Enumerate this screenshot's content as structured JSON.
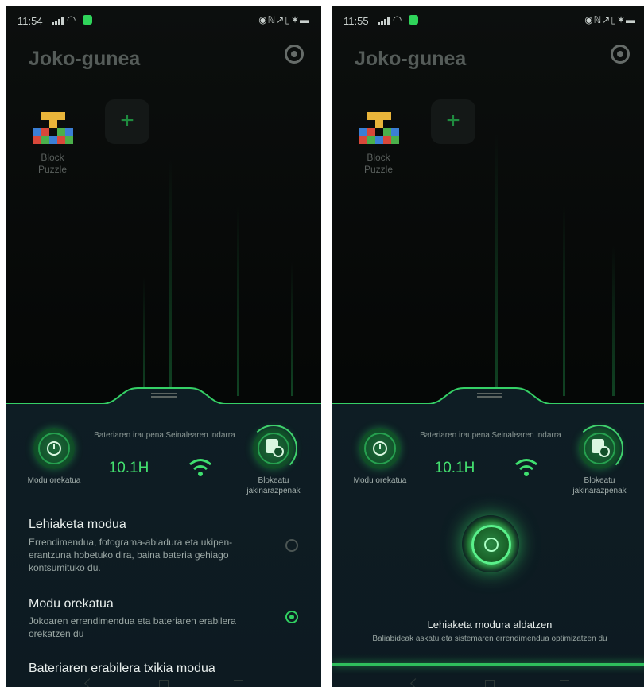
{
  "left": {
    "status_time": "11:54",
    "title": "Joko-gunea",
    "game_label": "Block\nPuzzle",
    "add_symbol": "+",
    "mode_caption": "Modu orekatua",
    "battery_label": "Bateriaren iraupena",
    "battery_value": "10.1H",
    "signal_label": "Seinalearen indarra",
    "block_caption": "Blokeatu jakinarazpenak",
    "options": [
      {
        "title": "Lehiaketa modua",
        "desc": "Errendimendua, fotograma-abiadura eta ukipen-erantzuna hobetuko dira, baina bateria gehiago kontsumituko du.",
        "selected": false
      },
      {
        "title": "Modu orekatua",
        "desc": "Jokoaren errendimendua eta bateriaren erabilera orekatzen du",
        "selected": true
      },
      {
        "title": "Bateriaren erabilera txikia modua",
        "desc": "",
        "selected": false
      }
    ]
  },
  "right": {
    "status_time": "11:55",
    "title": "Joko-gunea",
    "game_label": "Block\nPuzzle",
    "add_symbol": "+",
    "mode_caption": "Modu orekatua",
    "battery_label": "Bateriaren iraupena",
    "battery_value": "10.1H",
    "signal_label": "Seinalearen indarra",
    "block_caption": "Blokeatu jakinarazpenak",
    "switch_title": "Lehiaketa modura aldatzen",
    "switch_desc": "Baliabideak askatu eta sistemaren errendimendua optimizatzen du"
  },
  "colors": {
    "accent": "#31d062",
    "panel": "#0e1d24",
    "background": "#050706"
  },
  "icons": [
    "signal-icon",
    "wifi-icon",
    "gear-icon",
    "add-icon",
    "mode-icon",
    "wifi-signal-icon",
    "block-notifications-icon",
    "radio-icon"
  ]
}
